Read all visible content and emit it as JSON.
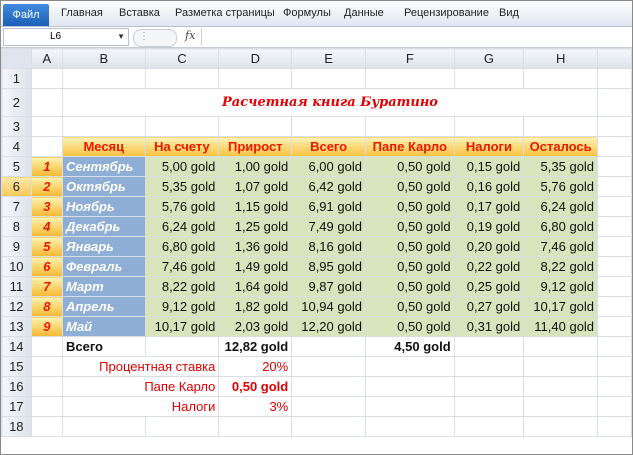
{
  "ribbon": {
    "file_tab": "Файл",
    "tabs": [
      "Главная",
      "Вставка",
      "Разметка страницы",
      "Формулы",
      "Данные",
      "Рецензирование",
      "Вид"
    ]
  },
  "formula_bar": {
    "cell_ref": "L6",
    "fx_label": "fx",
    "content": ""
  },
  "columns": [
    "A",
    "B",
    "C",
    "D",
    "E",
    "F",
    "G",
    "H"
  ],
  "rows": [
    "1",
    "2",
    "3",
    "4",
    "5",
    "6",
    "7",
    "8",
    "9",
    "10",
    "11",
    "12",
    "13",
    "14",
    "15",
    "16",
    "17",
    "18"
  ],
  "sheet": {
    "title": "Расчетная книга Буратино",
    "headers": [
      "Месяц",
      "На счету",
      "Прирост",
      "Всего",
      "Папе Карло",
      "Налоги",
      "Осталось"
    ],
    "data_rows": [
      {
        "n": "1",
        "month": "Сентябрь",
        "balance": "5,00 gold",
        "growth": "1,00 gold",
        "total": "6,00 gold",
        "carlo": "0,50 gold",
        "tax": "0,15 gold",
        "rest": "5,35 gold"
      },
      {
        "n": "2",
        "month": "Октябрь",
        "balance": "5,35 gold",
        "growth": "1,07 gold",
        "total": "6,42 gold",
        "carlo": "0,50 gold",
        "tax": "0,16 gold",
        "rest": "5,76 gold"
      },
      {
        "n": "3",
        "month": "Ноябрь",
        "balance": "5,76 gold",
        "growth": "1,15 gold",
        "total": "6,91 gold",
        "carlo": "0,50 gold",
        "tax": "0,17 gold",
        "rest": "6,24 gold"
      },
      {
        "n": "4",
        "month": "Декабрь",
        "balance": "6,24 gold",
        "growth": "1,25 gold",
        "total": "7,49 gold",
        "carlo": "0,50 gold",
        "tax": "0,19 gold",
        "rest": "6,80 gold"
      },
      {
        "n": "5",
        "month": "Январь",
        "balance": "6,80 gold",
        "growth": "1,36 gold",
        "total": "8,16 gold",
        "carlo": "0,50 gold",
        "tax": "0,20 gold",
        "rest": "7,46 gold"
      },
      {
        "n": "6",
        "month": "Февраль",
        "balance": "7,46 gold",
        "growth": "1,49 gold",
        "total": "8,95 gold",
        "carlo": "0,50 gold",
        "tax": "0,22 gold",
        "rest": "8,22 gold"
      },
      {
        "n": "7",
        "month": "Март",
        "balance": "8,22 gold",
        "growth": "1,64 gold",
        "total": "9,87 gold",
        "carlo": "0,50 gold",
        "tax": "0,25 gold",
        "rest": "9,12 gold"
      },
      {
        "n": "8",
        "month": "Апрель",
        "balance": "9,12 gold",
        "growth": "1,82 gold",
        "total": "10,94 gold",
        "carlo": "0,50 gold",
        "tax": "0,27 gold",
        "rest": "10,17 gold"
      },
      {
        "n": "9",
        "month": "Май",
        "balance": "10,17 gold",
        "growth": "2,03 gold",
        "total": "12,20 gold",
        "carlo": "0,50 gold",
        "tax": "0,31 gold",
        "rest": "11,40 gold"
      }
    ],
    "totals": {
      "label": "Всего",
      "growth": "12,82 gold",
      "carlo": "4,50 gold"
    },
    "params": [
      {
        "label": "Процентная ставка",
        "value": "20%"
      },
      {
        "label": "Папе Карло",
        "value": "0,50 gold"
      },
      {
        "label": "Налоги",
        "value": "3%"
      }
    ]
  },
  "colors": {
    "header_text": "#e81a00",
    "month_fill": "#8eaed6",
    "value_fill": "#d8e4bc",
    "title": "#e30000"
  }
}
